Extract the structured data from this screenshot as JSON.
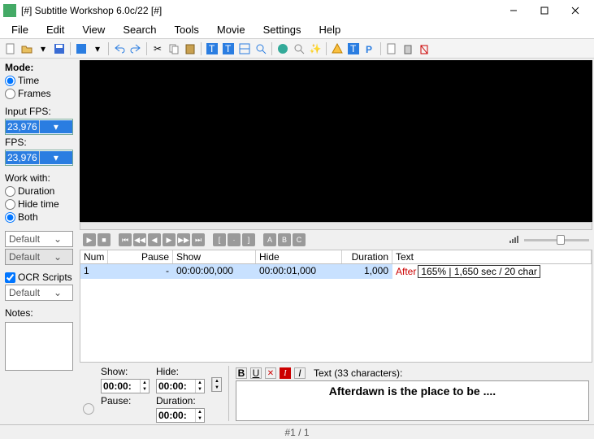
{
  "window": {
    "title": "[#] Subtitle Workshop 6.0c/22 [#]"
  },
  "menu": [
    "File",
    "Edit",
    "View",
    "Search",
    "Tools",
    "Movie",
    "Settings",
    "Help"
  ],
  "left": {
    "mode_label": "Mode:",
    "mode_time": "Time",
    "mode_frames": "Frames",
    "input_fps_label": "Input FPS:",
    "input_fps": "23,976",
    "fps_label": "FPS:",
    "fps": "23,976",
    "workwith_label": "Work with:",
    "ww_duration": "Duration",
    "ww_hide": "Hide time",
    "ww_both": "Both",
    "combo1": "Default",
    "combo2": "Default",
    "ocr_label": "OCR Scripts",
    "ocr_combo": "Default",
    "notes_label": "Notes:"
  },
  "grid": {
    "cols": {
      "num": "Num",
      "pause": "Pause",
      "show": "Show",
      "hide": "Hide",
      "duration": "Duration",
      "text": "Text"
    },
    "row": {
      "num": "1",
      "pause": "-",
      "show": "00:00:00,000",
      "hide": "00:00:01,000",
      "duration": "1,000",
      "text_prefix": "After",
      "badge": "165%  |  1,650 sec / 20 char"
    }
  },
  "time": {
    "show_label": "Show:",
    "show": "00:00:",
    "hide_label": "Hide:",
    "hide": "00:00:",
    "pause_label": "Pause:",
    "duration_label": "Duration:",
    "duration": "00:00:"
  },
  "text": {
    "counter": "Text (33 characters):",
    "content": "Afterdawn is the place to be ...."
  },
  "status": "#1 / 1"
}
